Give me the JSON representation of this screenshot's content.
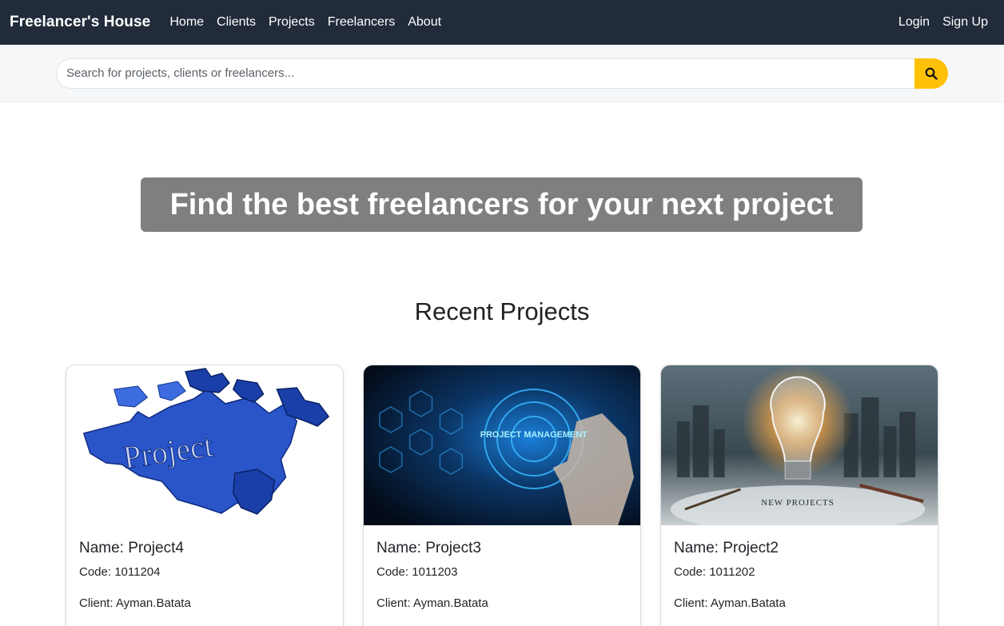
{
  "navbar": {
    "brand": "Freelancer's House",
    "links": [
      "Home",
      "Clients",
      "Projects",
      "Freelancers",
      "About"
    ],
    "right_links": [
      "Login",
      "Sign Up"
    ]
  },
  "search": {
    "placeholder": "Search for projects, clients or freelancers...",
    "button_icon": "search-icon"
  },
  "hero": {
    "title": "Find the best freelancers for your next project"
  },
  "recent": {
    "title": "Recent Projects",
    "projects": [
      {
        "name": "Name: Project4",
        "code": "Code: 1011204",
        "client": "Client: Ayman.Batata",
        "image_text": "Project"
      },
      {
        "name": "Name: Project3",
        "code": "Code: 1011203",
        "client": "Client: Ayman.Batata",
        "image_text": "PROJECT MANAGEMENT"
      },
      {
        "name": "Name: Project2",
        "code": "Code: 1011202",
        "client": "Client: Ayman.Batata",
        "image_text": "NEW PROJECTS"
      }
    ]
  },
  "colors": {
    "navbar": "#212b3a",
    "accent": "#ffc107",
    "hero_bg": "#7f7f7f"
  }
}
